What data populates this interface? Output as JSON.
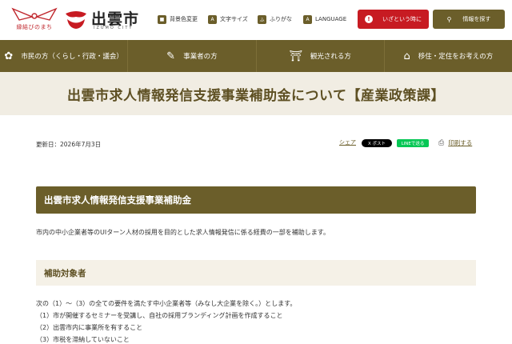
{
  "header": {
    "enmusubi_text": "縁結びのまち",
    "city_name": "出雲市",
    "city_sub": "IZUMO CITY",
    "utilities": [
      {
        "icon": "palette-icon",
        "label": "背景色変更"
      },
      {
        "icon": "font-size-icon",
        "label": "文字サイズ"
      },
      {
        "icon": "furigana-icon",
        "label": "ふりがな"
      },
      {
        "icon": "language-icon",
        "label": "LANGUAGE"
      }
    ],
    "emergency_label": "いざという時に",
    "info_label": "情報を探す",
    "colors": {
      "brand": "#6b5e2a",
      "emergency": "#c71b22"
    }
  },
  "nav": [
    {
      "icon": "flower-icon",
      "label": "市民の方（くらし・行政・議会）"
    },
    {
      "icon": "pen-icon",
      "label": "事業者の方"
    },
    {
      "icon": "torii-icon",
      "label": "観光される方"
    },
    {
      "icon": "house-icon",
      "label": "移住・定住をお考えの方"
    }
  ],
  "page": {
    "title": "出雲市求人情報発信支援事業補助金について【産業政策課】",
    "updated": "更新日：2026年7月3日",
    "share_label": "シェア",
    "x_post_label": "X ポスト",
    "line_label": "LINEで送る",
    "print_label": "印刷する"
  },
  "content": {
    "h2": "出雲市求人情報発信支援事業補助金",
    "lead": "市内の中小企業者等のUIターン人材の採用を目的とした求人情報発信に係る経費の一部を補助します。",
    "h3": "補助対象者",
    "lines": [
      "次の（1）～（3）の全ての要件を満たす中小企業者等（みなし大企業を除く。）とします。",
      "（1）市が開催するセミナーを受講し、自社の採用ブランディング計画を作成すること",
      "（2）出雲市内に事業所を有すること",
      "（3）市税を滞納していないこと"
    ]
  }
}
